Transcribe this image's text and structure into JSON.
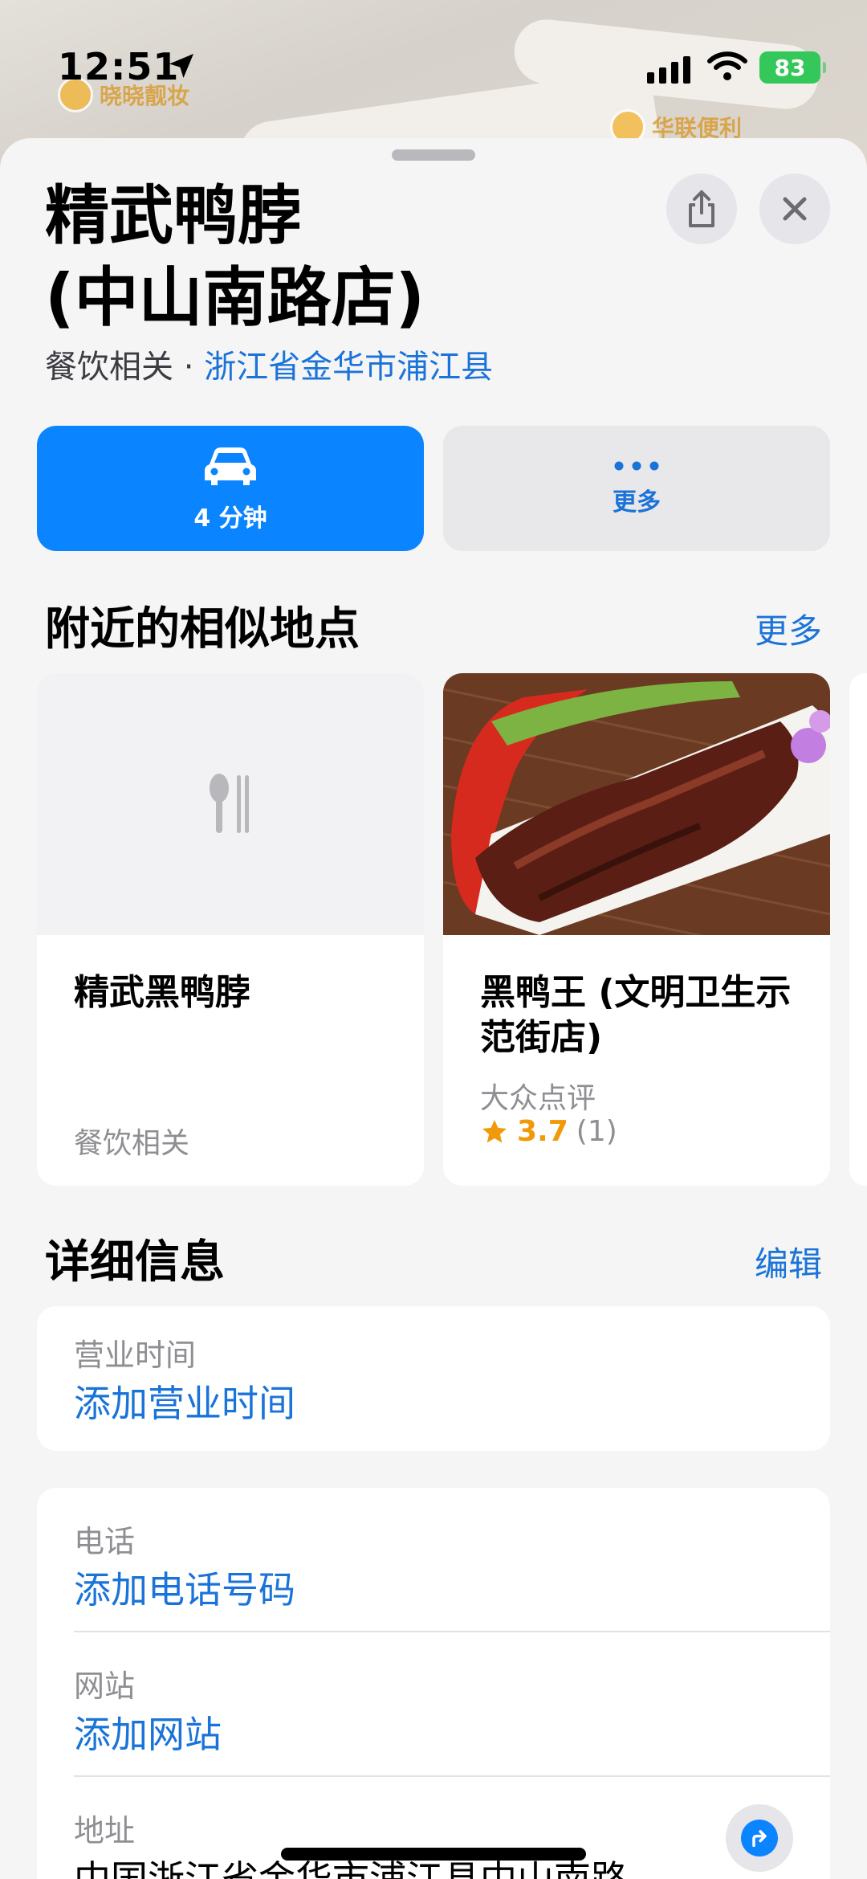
{
  "status_bar": {
    "time": "12:51",
    "battery": "83"
  },
  "map": {
    "poi_left": "晓晓靓妆",
    "poi_right": "华联便利"
  },
  "place": {
    "title_line1": "精武鸭脖",
    "title_line2": "(中山南路店)",
    "category": "餐饮相关 · ",
    "location_link": "浙江省金华市浦江县"
  },
  "actions": {
    "drive_label": "4 分钟",
    "more_label": "更多"
  },
  "nearby": {
    "title": "附近的相似地点",
    "more_link": "更多",
    "cards": [
      {
        "name": "精武黑鸭脖",
        "category": "餐饮相关"
      },
      {
        "name": "黑鸭王 (文明卫生示范街店)",
        "source": "大众点评",
        "rating": "3.7",
        "review_count": "(1)"
      }
    ]
  },
  "details": {
    "title": "详细信息",
    "edit_link": "编辑",
    "hours_label": "营业时间",
    "hours_value": "添加营业时间",
    "phone_label": "电话",
    "phone_value": "添加电话号码",
    "website_label": "网站",
    "website_value": "添加网站",
    "address_label": "地址",
    "address_value": "中国浙江省金华市浦江县中山南路"
  },
  "colors": {
    "accent": "#0a84ff",
    "link": "#1a73d9",
    "rating": "#f09a0a",
    "battery": "#34c759"
  }
}
